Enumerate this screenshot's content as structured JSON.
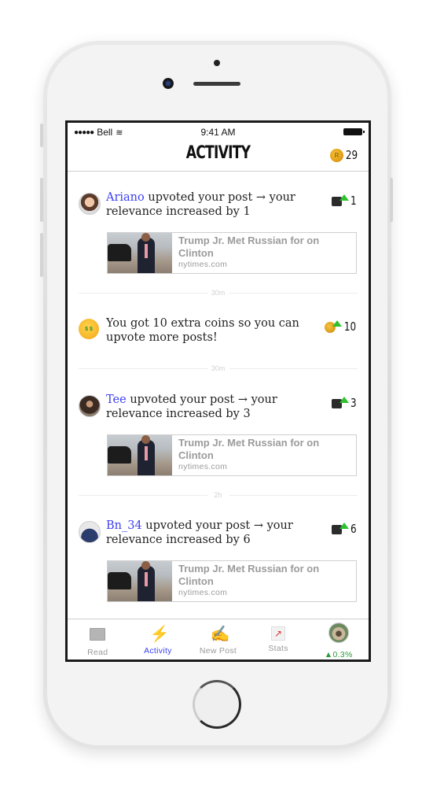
{
  "device": {
    "model": "iPhone"
  },
  "status_bar": {
    "carrier": "Bell",
    "signal": "●●●●●",
    "time": "9:41 AM"
  },
  "header": {
    "title": "ACTIVITY",
    "coin_count": "29",
    "coin_icon": "coin-icon"
  },
  "feed": {
    "items": [
      {
        "type": "upvote",
        "username": "Ariano",
        "message": " upvoted your post → your relevance increased by 1",
        "badge_icon": "relevance-up-icon",
        "badge_value": "1",
        "link": {
          "title": "Trump Jr. Met Russian for on Clinton",
          "domain": "nytimes.com"
        }
      },
      {
        "type": "coins",
        "emoji": "money-mouth-face-icon",
        "message": "You got 10 extra coins so you can upvote more posts!",
        "badge_icon": "coin-up-icon",
        "badge_value": "10"
      },
      {
        "type": "upvote",
        "username": "Tee",
        "message": " upvoted your post → your relevance increased by 3",
        "badge_icon": "relevance-up-icon",
        "badge_value": "3",
        "link": {
          "title": "Trump Jr. Met Russian for on Clinton",
          "domain": "nytimes.com"
        }
      },
      {
        "type": "upvote",
        "username": "Bn_34",
        "message": " upvoted your post → your relevance increased by 6",
        "badge_icon": "relevance-up-icon",
        "badge_value": "6",
        "link": {
          "title": "Trump Jr. Met Russian for on Clinton",
          "domain": "nytimes.com"
        }
      }
    ],
    "separators": [
      "30m",
      "30m",
      "2h"
    ]
  },
  "tab_bar": {
    "active": "Activity",
    "tabs": [
      {
        "label": "Read",
        "icon": "newspaper-icon"
      },
      {
        "label": "Activity",
        "icon": "lightning-icon"
      },
      {
        "label": "New Post",
        "icon": "writing-hand-icon"
      },
      {
        "label": "Stats",
        "icon": "chart-icon"
      },
      {
        "label": "▲0.3%",
        "icon": "profile-avatar"
      }
    ]
  },
  "colors": {
    "accent": "#3a3ff0",
    "gain": "#2a9a3a",
    "coin": "#e2a015",
    "arrow": "#2fc02f"
  }
}
